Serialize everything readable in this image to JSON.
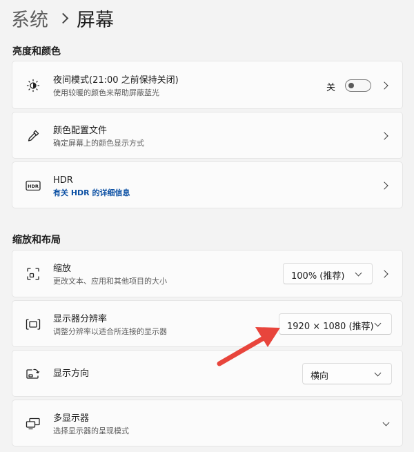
{
  "breadcrumb": {
    "parent": "系统",
    "current": "屏幕"
  },
  "sections": {
    "brightness": "亮度和颜色",
    "scale_layout": "缩放和布局"
  },
  "night_light": {
    "title": "夜间模式(21:00 之前保持关闭)",
    "subtitle": "使用较暖的颜色来帮助屏蔽蓝光",
    "state_label": "关",
    "toggle_on": false,
    "icon": "sun-moon-icon"
  },
  "color_profile": {
    "title": "颜色配置文件",
    "subtitle": "确定屏幕上的颜色显示方式",
    "icon": "eyedropper-icon"
  },
  "hdr": {
    "title": "HDR",
    "link": "有关 HDR 的详细信息",
    "icon": "hdr-icon"
  },
  "scale": {
    "title": "缩放",
    "subtitle": "更改文本、应用和其他项目的大小",
    "value": "100% (推荐)",
    "icon": "scale-icon"
  },
  "resolution": {
    "title": "显示器分辨率",
    "subtitle": "调整分辨率以适合所连接的显示器",
    "value": "1920 × 1080 (推荐)",
    "icon": "resolution-icon"
  },
  "orientation": {
    "title": "显示方向",
    "value": "横向",
    "icon": "rotate-screen-icon"
  },
  "multi_display": {
    "title": "多显示器",
    "subtitle": "选择显示器的呈现模式",
    "icon": "multi-monitor-icon"
  },
  "colors": {
    "annotation_arrow": "#e8453c",
    "link": "#0a4fa3"
  }
}
